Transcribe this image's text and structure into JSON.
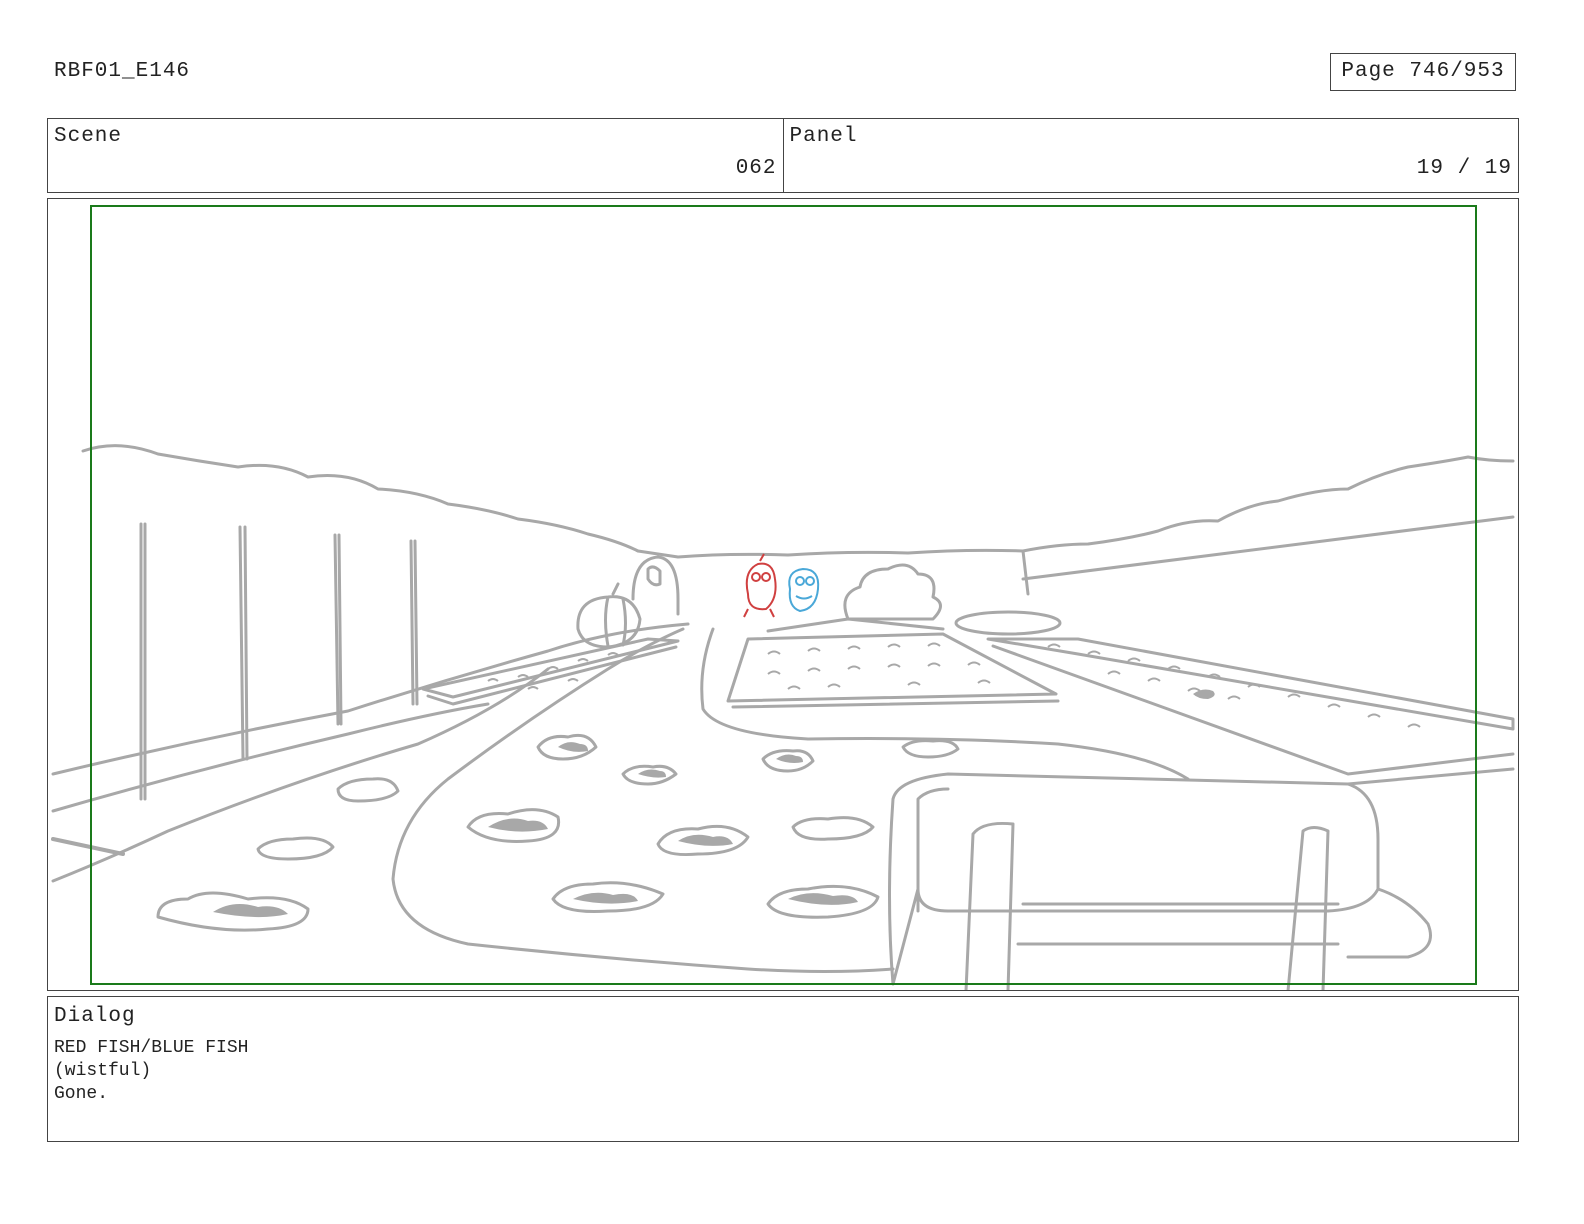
{
  "header": {
    "document_id": "RBF01_E146",
    "page_label": "Page 746/953"
  },
  "scene": {
    "label": "Scene",
    "value": "062"
  },
  "panel": {
    "label": "Panel",
    "value": "19 / 19"
  },
  "dialog": {
    "label": "Dialog",
    "lines": [
      "RED FISH/BLUE FISH",
      "(wistful)",
      "Gone."
    ]
  },
  "colors": {
    "safe_frame": "#1a7a1a",
    "sketch_line": "#a8a8a8",
    "red_fish": "#d04040",
    "blue_fish": "#4aa8d8",
    "border": "#444444"
  }
}
